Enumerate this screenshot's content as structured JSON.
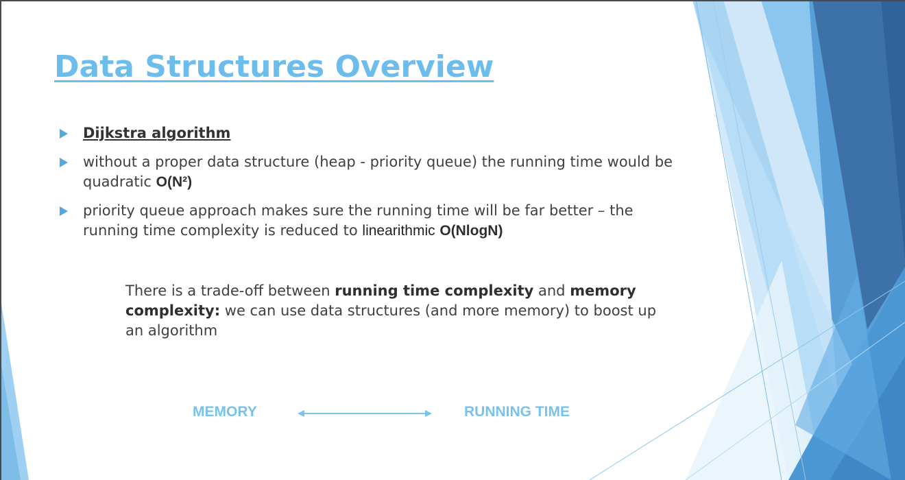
{
  "slide": {
    "title": "Data Structures Overview",
    "bullets": [
      {
        "text": "Dijkstra algorithm"
      },
      {
        "text_a": "without a proper data structure (heap - priority queue) the running time would be quadratic ",
        "complexity": "O(N²)"
      },
      {
        "text_a": "priority queue approach makes sure the running time will be far better – the running time complexity is reduced to ",
        "term": "linearithmic",
        "complexity": "O(NlogN)"
      }
    ],
    "tradeoff": {
      "part1": "There is a trade-off between ",
      "bold1": "running time complexity",
      "part2": " and ",
      "bold2": "memory complexity:",
      "part3": " we can use data structures (and more memory) to boost up an algorithm"
    },
    "scale": {
      "left_label": "MEMORY",
      "right_label": "RUNNING TIME"
    }
  },
  "colors": {
    "title": "#6cbdec",
    "bullet_marker": "#55a7e0",
    "scale_label": "#79c2ec",
    "deco_dark": "#3a6ea5",
    "deco_light": "#9fd0f2"
  }
}
